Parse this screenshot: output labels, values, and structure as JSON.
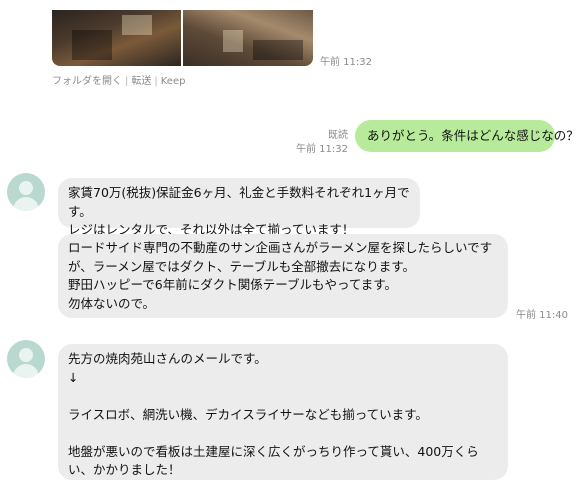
{
  "photos": {
    "time": "午前 11:32"
  },
  "actions": {
    "open_folder": "フォルダを開く",
    "forward": "転送",
    "keep": "Keep"
  },
  "outgoing": {
    "read_label": "既読",
    "time": "午前 11:32",
    "text": "ありがとう。条件はどんな感じなの？"
  },
  "incoming1": {
    "text": "家賃70万(税抜)保証金6ヶ月、礼金と手数料それぞれ1ヶ月です。\nレジはレンタルで、それ以外は全て揃っています！"
  },
  "incoming2": {
    "text": "ロードサイド専門の不動産のサン企画さんがラーメン屋を探したらしいですが、ラーメン屋ではダクト、テーブルも全部撤去になります。\n野田ハッピーで6年前にダクト関係テーブルもやってます。\n勿体ないので。",
    "time": "午前 11:40"
  },
  "incoming3": {
    "text": "先方の焼肉苑山さんのメールです。\n↓\n\nライスロボ、網洗い機、デカイスライサーなども揃っています。\n\n地盤が悪いので看板は土建屋に深く広くがっちり作って貰い、400万くらい、かかりました！"
  }
}
